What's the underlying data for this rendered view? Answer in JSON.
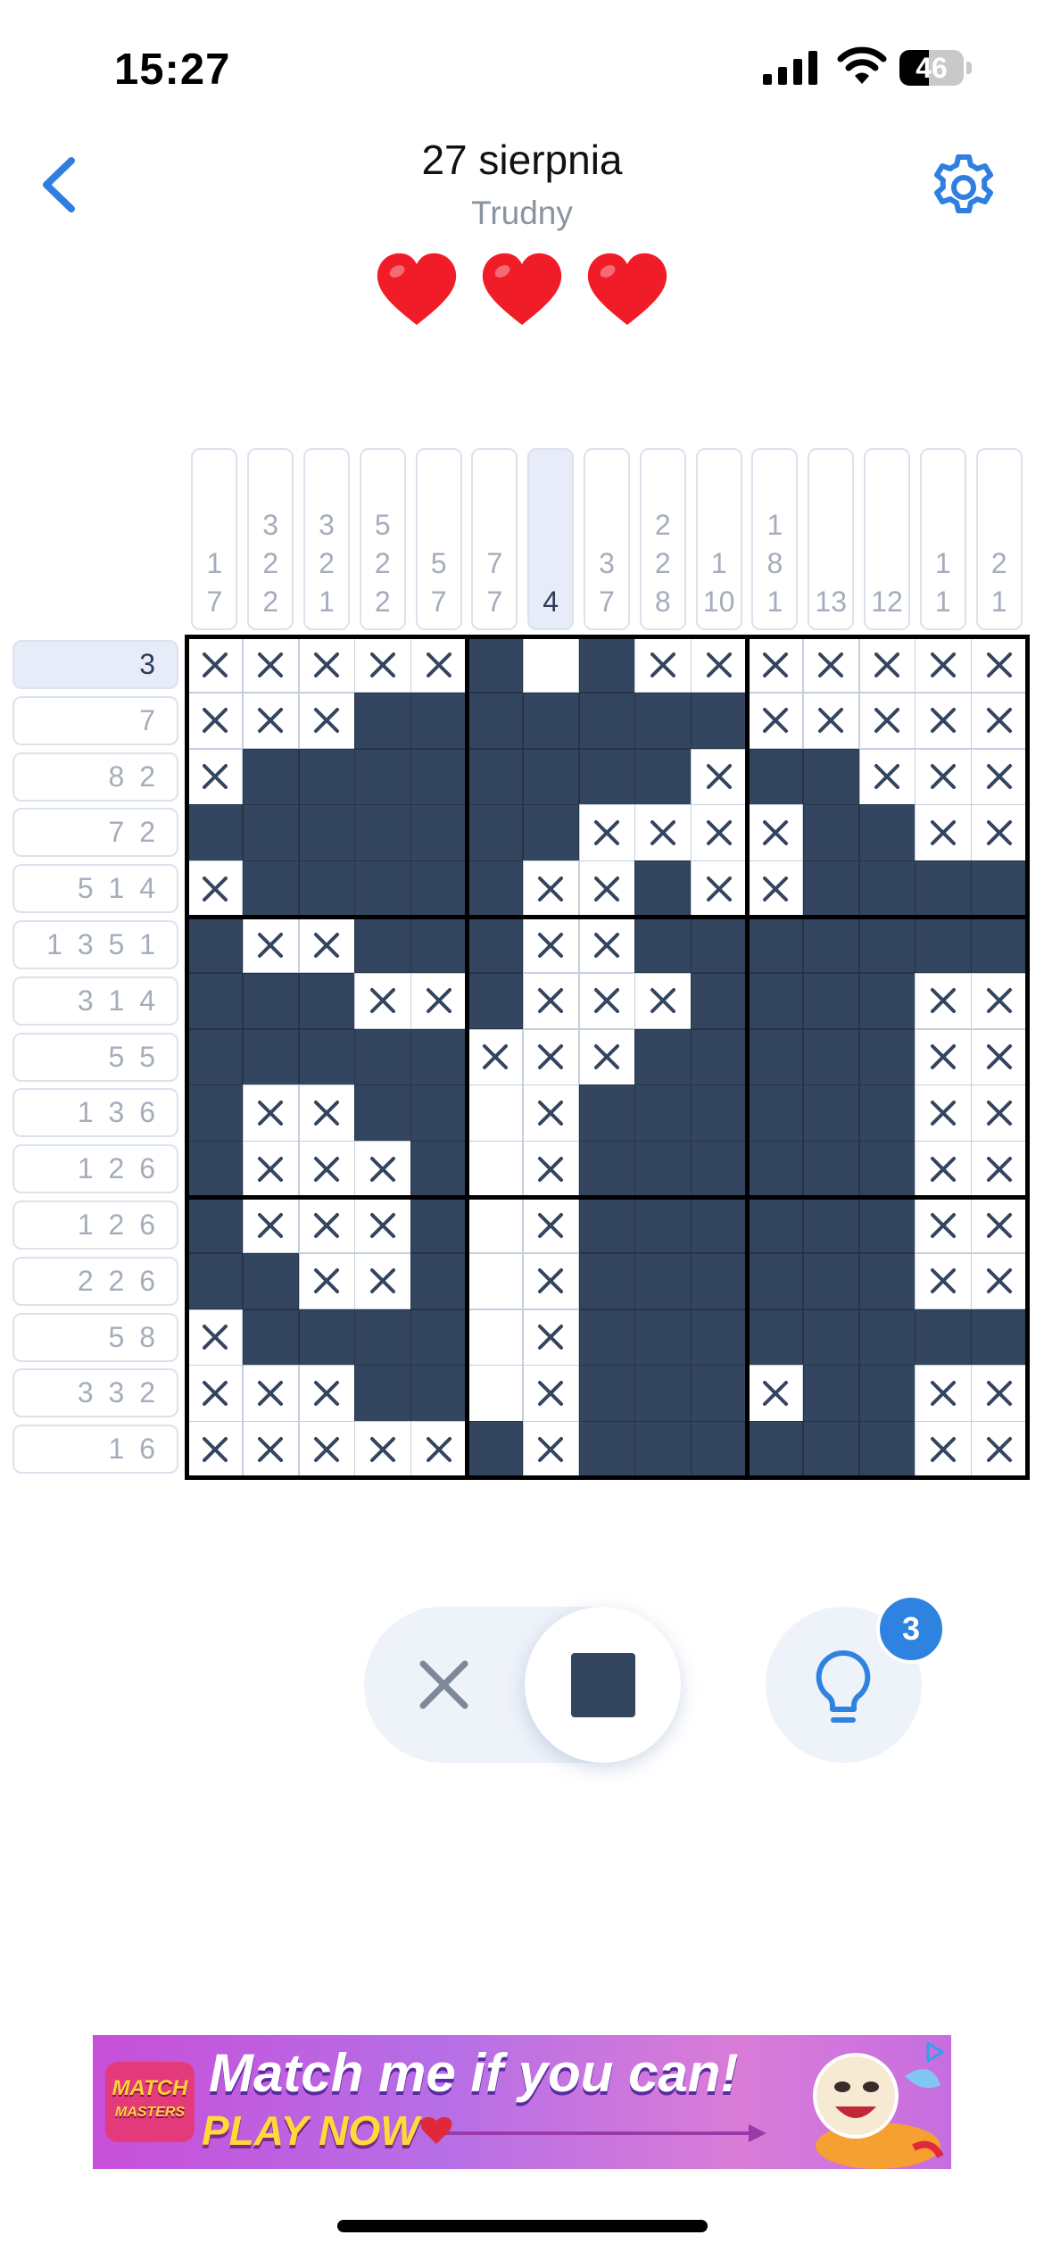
{
  "status_bar": {
    "time": "15:27",
    "battery": "46"
  },
  "header": {
    "title": "27 sierpnia",
    "difficulty": "Trudny",
    "lives": 3,
    "lives_max": 3
  },
  "puzzle": {
    "active_col": 6,
    "active_row": 0,
    "col_clues": [
      [
        "1",
        "7"
      ],
      [
        "3",
        "2",
        "2"
      ],
      [
        "3",
        "2",
        "1"
      ],
      [
        "5",
        "2",
        "2"
      ],
      [
        "5",
        "7"
      ],
      [
        "7",
        "7"
      ],
      [
        "4"
      ],
      [
        "3",
        "7"
      ],
      [
        "2",
        "2",
        "8"
      ],
      [
        "1",
        "10"
      ],
      [
        "1",
        "8",
        "1"
      ],
      [
        "13"
      ],
      [
        "12"
      ],
      [
        "1",
        "1"
      ],
      [
        "2",
        "1"
      ]
    ],
    "row_clues": [
      "3",
      "7",
      "8 2",
      "7 2",
      "5 1 4",
      "1 3 5 1",
      "3 1 4",
      "5 5",
      "1 3 6",
      "1 2 6",
      "1 2 6",
      "2 2 6",
      "5 8",
      "3 3 2",
      "1 6"
    ],
    "grid": [
      "XXXXX#.#XXXXXXX",
      "XXX#######XXXXX",
      "X########X##XXX",
      "#######XXXX##XX",
      "X#####XX#XX####",
      "#XX###XX#######",
      "###XX#XXX####XX",
      "#####XXX#####XX",
      "#XX##.X######XX",
      "#XXX#.X######XX",
      "#XXX#.X######XX",
      "##XX#.X######XX",
      "X####.X########",
      "XXX##.X###X##XX",
      "XXXXX#X######XX"
    ]
  },
  "controls": {
    "mode_selected": "fill",
    "hint_count": "3"
  },
  "ad": {
    "logo_line1": "MATCH",
    "logo_line2": "MASTERS",
    "headline": "Match me if you can!",
    "cta": "PLAY NOW"
  }
}
